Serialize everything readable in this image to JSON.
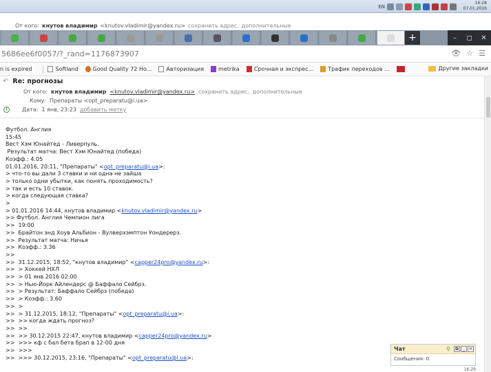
{
  "taskbar": {
    "lang": "EN",
    "time": "16:28",
    "date": "07.01.2016"
  },
  "ghost_header": {
    "from_label": "От кого:",
    "from_name": "кнутов владимир",
    "from_email": "<knutov.vladimir@yandex.ru>",
    "save_address": "сохранить адрес,",
    "more": "дополнительные"
  },
  "browser": {
    "url": "5686ee6f0057/?_rand=1176873907",
    "tab_icons": [
      "chart-icon",
      "game-icon",
      "green-icon",
      "green-icon",
      "globe-icon",
      "globe-icon",
      "vk-icon",
      "pb-icon",
      "b-icon",
      "x-icon",
      "b-icon",
      "gear-icon",
      "green-icon",
      "blank-icon"
    ],
    "new_tab": "+",
    "window_controls": [
      "–",
      "◻",
      "✕"
    ]
  },
  "bookmarks": {
    "items": [
      {
        "label": "n is expired",
        "icon": "none"
      },
      {
        "label": "Softland",
        "icon": "doc-icon"
      },
      {
        "label": "Good Quality 72 Ho...",
        "icon": "doc-icon"
      },
      {
        "label": "Авторизация",
        "icon": "doc-icon"
      },
      {
        "label": "metrika",
        "icon": "metrika-icon"
      },
      {
        "label": "Срочная и экспрес...",
        "icon": "red-icon"
      },
      {
        "label": "Трафик переходов ...",
        "icon": "traffic-icon"
      },
      {
        "label": "",
        "icon": "red-badge-icon"
      }
    ],
    "other": "Другие закладки"
  },
  "mail": {
    "subject": "Re: прогнозы",
    "from_label": "От кого:",
    "from_name": "кнутов владимир",
    "from_email": "<knutov.vladimir@yandex.ru>",
    "save_address": "сохранить адрес,",
    "more": "дополнительные",
    "to_label": "Кому:",
    "to_value": "Препараты <opt_preparatu@i.ua>",
    "date_label": "Дата:",
    "date_value": "1 янв, 23:23",
    "add_tag": "добавить метку",
    "body_lines": [
      "Футбол. Англия",
      "15:45",
      "Вест Хэм Юнайтед - Ливерпуль.",
      " Результат матча: Вест Хэм Юнайтед (победа)",
      "Коэфф.: 4.05",
      "",
      "01.01.2016, 20:11, \"Препараты\" <opt_preparatu@i.ua>:",
      "> что-то вы дали 3 ставки и ни одна не зайша",
      "> только одни убытки, как понять проходимость?",
      "> так и есть 10 ставок.",
      "> когда следующая ставка?",
      ">",
      "> 01.01.2016 14:44, кнутов владимир <knutov.vladimir@yandex.ru>",
      ">> Футбол. Англия Чемпион лига",
      ">>  19:00",
      ">>  Брайтон энд Хоув Альбион - Вулверхэмптон Уондерерз.",
      ">>  Результат матча: Ничья",
      ">>  Коэфф.: 3.36",
      ">>",
      ">>  31.12.2015, 18:52, \"кнутов владимир\" <capper24pro@yandex.ru>:",
      ">>  > Хоккей НХЛ",
      ">>  > 01 янв 2016 02:00",
      ">>  > Нью-Йорк Айлендерс @ Баффало Сейбрз.",
      ">>  > Результат: Баффало Сейбрз (победа)",
      ">>  > Коэфф.: 3.60",
      ">>  >",
      ">>  > 31.12.2015, 18:12, \"Препараты\" <opt_preparatu@i.ua>:",
      ">>  >> когда ждать прогноз?",
      ">>  >>",
      ">>  >> 30.12.2015 22:47, кнутов владимир <capper24pro@yandex.ru>",
      ">>  >>> кф с бал бета брап в 12-00 дня",
      ">>  >>>",
      ">>  >>> 30.12.2015, 23:16, \"Препараты\" <opt_preparatu@i.ua>:"
    ]
  },
  "chat": {
    "title": "Чат",
    "messages_label": "Сообщения: 0"
  },
  "bottom_time": "16:29"
}
